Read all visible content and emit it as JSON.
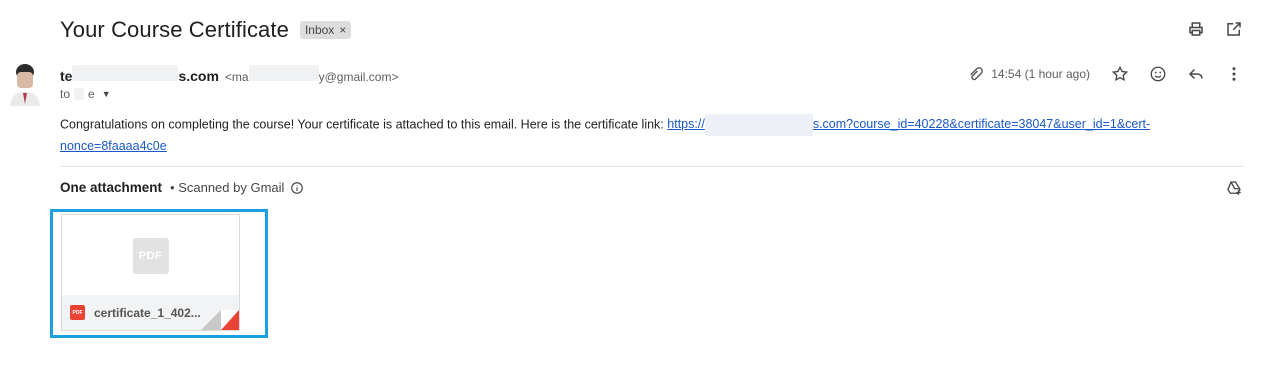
{
  "email": {
    "subject": "Your Course Certificate",
    "label": "Inbox",
    "label_close": "×",
    "sender_name_start": "te",
    "sender_name_end": "s.com",
    "sender_email_start": "<ma",
    "sender_email_end": "y@gmail.com>",
    "to_prefix": "to",
    "to_suffix": "e",
    "time": "14:54 (1 hour ago)",
    "body_text": "Congratulations on completing the course! Your certificate is attached to this email. Here is the certificate link:",
    "link_start": "https://",
    "link_end": "s.com?course_id=40228&certificate=38047&user_id=1&cert-nonce=8faaaa4c0e"
  },
  "attachments": {
    "count_label": "One attachment",
    "scanned_label": "• Scanned by Gmail",
    "file_name": "certificate_1_402...",
    "preview_badge": "PDF",
    "type_badge": "PDF"
  },
  "icons": {
    "print": "print-icon",
    "open_new_window": "open-in-new-icon",
    "attachment_clip": "paperclip-icon",
    "star": "star-icon",
    "emoji": "emoji-icon",
    "reply": "reply-icon",
    "more": "more-vert-icon",
    "info": "info-icon",
    "add_to_drive": "add-to-drive-icon"
  },
  "colors": {
    "link": "#1a58c7",
    "highlight_frame": "#1ba0e2",
    "pdf_red": "#ea4335"
  }
}
